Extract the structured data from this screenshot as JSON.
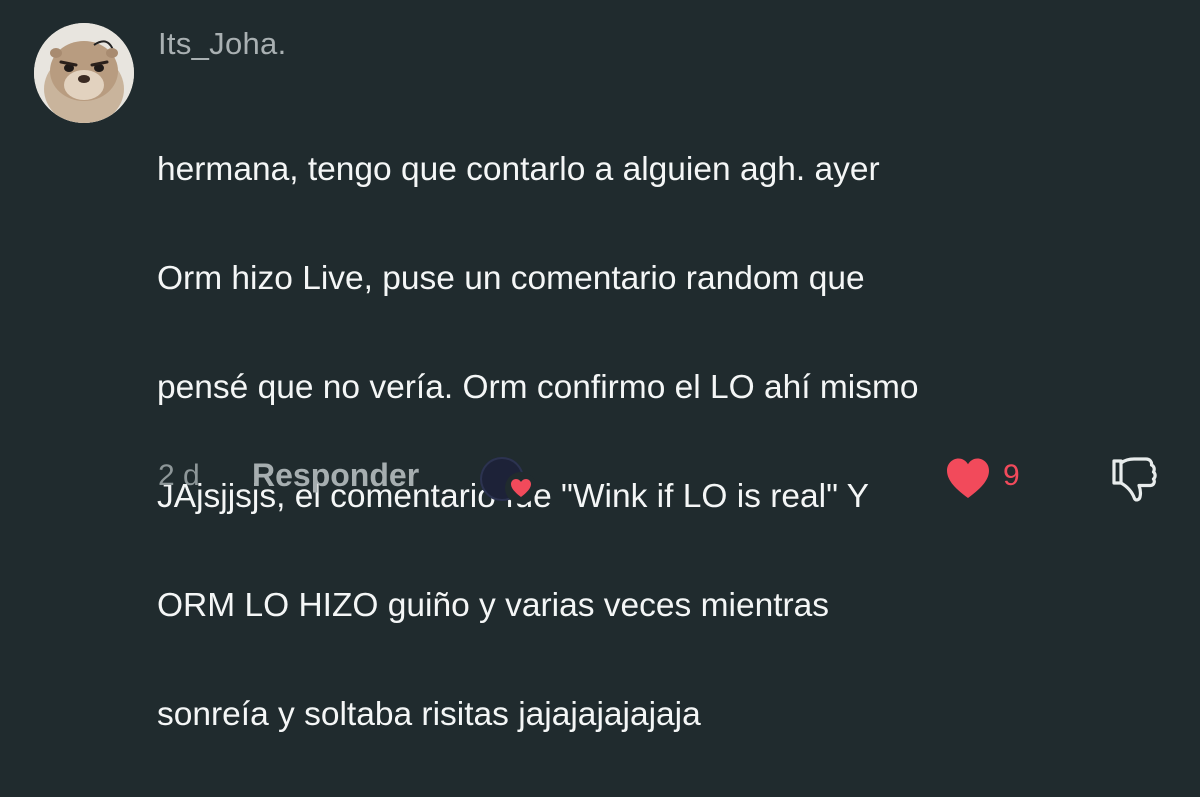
{
  "comment": {
    "username": "Its_Joha.",
    "avatar_icon": "plush-otter-avatar",
    "text_lines": [
      "hermana, tengo que contarlo a alguien agh. ayer",
      "Orm hizo Live, puse un comentario random que",
      "pensé que no vería. Orm confirmo el LO ahí mismo",
      "JAjsjjsjs, el comentario fue \"Wink if LO is real\" Y",
      "ORM LO HIZO guiño y varias veces mientras",
      "sonreía y soltaba risitas jajajajajajaja"
    ],
    "time": "2 d",
    "reply_label": "Responder",
    "liker_icon": "liker-avatar-with-heart-badge",
    "like_icon": "heart-icon",
    "like_count": "9",
    "dislike_icon": "thumbs-down-icon"
  },
  "colors": {
    "background": "#202b2e",
    "text": "#f4f6f6",
    "muted": "#a9b0b2",
    "like": "#f24a5b"
  }
}
